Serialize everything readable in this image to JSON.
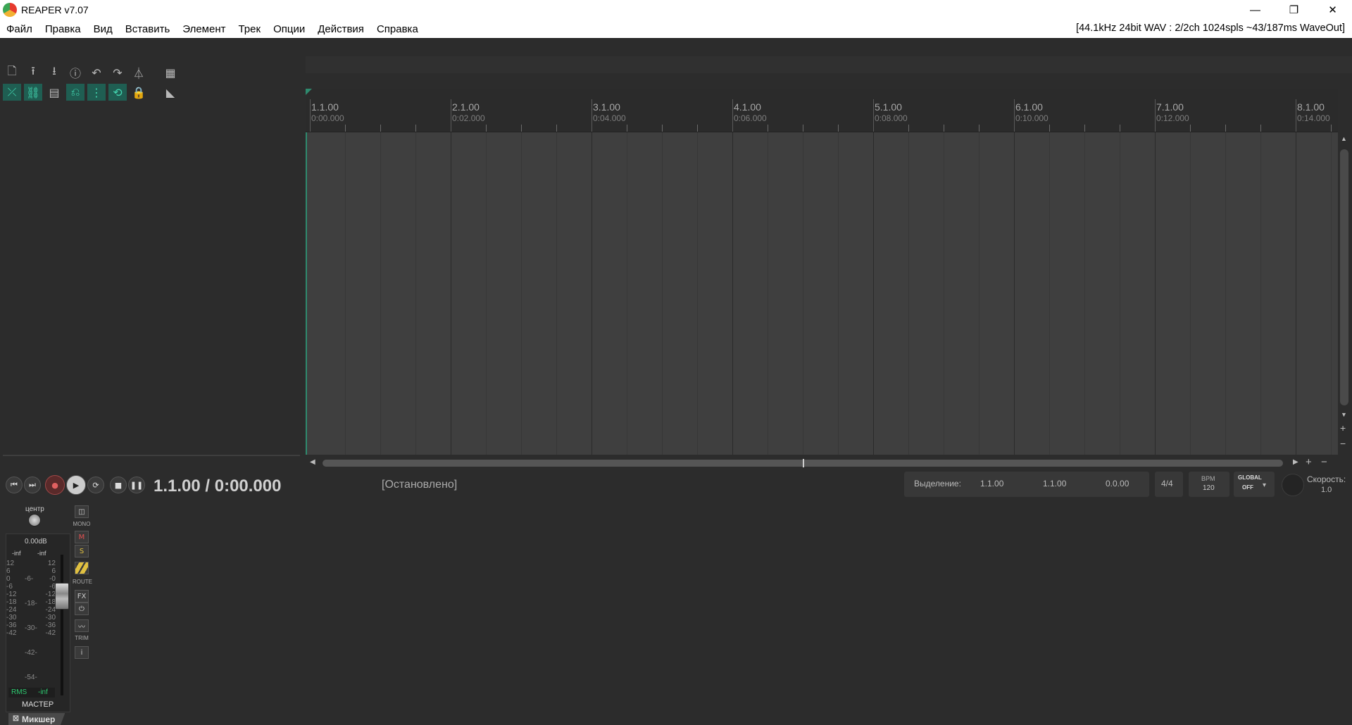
{
  "window": {
    "title": "REAPER v7.07",
    "minimize": "—",
    "restore": "❐",
    "close": "✕"
  },
  "menu": {
    "items": [
      "Файл",
      "Правка",
      "Вид",
      "Вставить",
      "Элемент",
      "Трек",
      "Опции",
      "Действия",
      "Справка"
    ],
    "status": "[44.1kHz 24bit WAV : 2/2ch 1024spls ~43/187ms WaveOut]"
  },
  "ruler": {
    "measures": [
      {
        "bar": "1.1.00",
        "time": "0:00.000"
      },
      {
        "bar": "2.1.00",
        "time": "0:02.000"
      },
      {
        "bar": "3.1.00",
        "time": "0:04.000"
      },
      {
        "bar": "4.1.00",
        "time": "0:06.000"
      },
      {
        "bar": "5.1.00",
        "time": "0:08.000"
      },
      {
        "bar": "6.1.00",
        "time": "0:10.000"
      },
      {
        "bar": "7.1.00",
        "time": "0:12.000"
      },
      {
        "bar": "8.1.00",
        "time": "0:14.000"
      }
    ]
  },
  "transport": {
    "time": "1.1.00 / 0:00.000",
    "state": "[Остановлено]",
    "selection_label": "Выделение:",
    "sel_start": "1.1.00",
    "sel_end": "1.1.00",
    "sel_len": "0.0.00",
    "timesig": "4/4",
    "bpm_label": "BPM",
    "bpm": "120",
    "global_label": "GLOBAL",
    "global_value": "OFF",
    "rate_label": "Скорость:",
    "rate": "1.0"
  },
  "master": {
    "pan_label": "центр",
    "volume": "0.00dB",
    "peak_l": "-inf",
    "peak_r": "-inf",
    "scale_left": [
      "12",
      "6",
      "0",
      "-6",
      "-12",
      "-18",
      "-24",
      "-30",
      "-36",
      "-42"
    ],
    "scale_mid": [
      "-6-",
      "-18-",
      "-30-",
      "-42-",
      "-54-"
    ],
    "scale_right": [
      "12",
      "6",
      "-0",
      "-6",
      "-12",
      "-18",
      "-24",
      "-30",
      "-36",
      "-42"
    ],
    "rms_label": "RMS",
    "rms_value": "-inf",
    "name": "МАСТЕР",
    "mono_label": "MONO",
    "mute": "M",
    "solo": "S",
    "route_label": "ROUTE",
    "fx": "FX",
    "trim_label": "TRIM",
    "info": "i"
  },
  "tabs": {
    "mixer": "Микшер"
  }
}
